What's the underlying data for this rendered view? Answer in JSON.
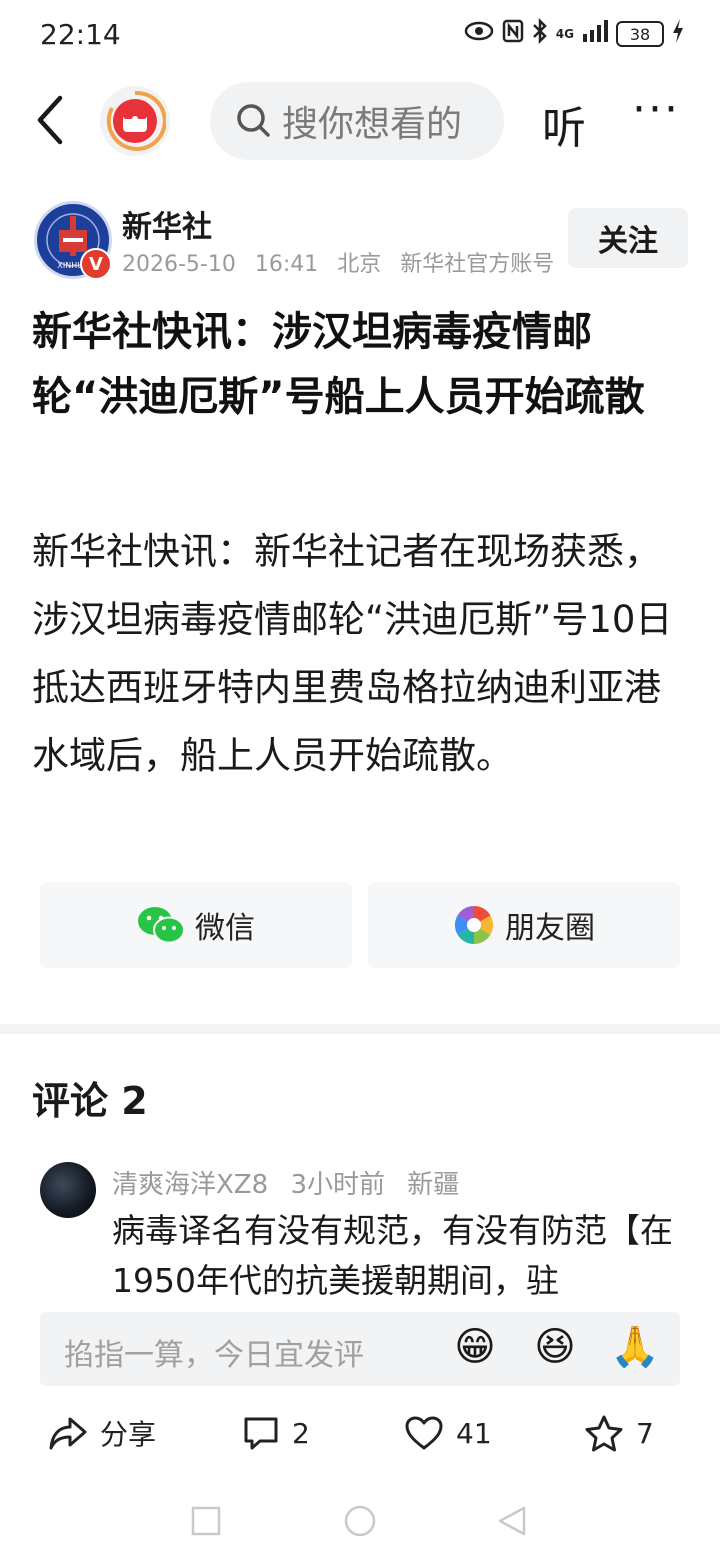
{
  "status_bar": {
    "time": "22:14",
    "network": "4G",
    "battery": "38"
  },
  "nav": {
    "search_placeholder": "搜你想看的",
    "listen_label": "听",
    "more_label": "···"
  },
  "author": {
    "name": "新华社",
    "date": "2026-5-10",
    "time": "16:41",
    "location": "北京",
    "account_type": "新华社官方账号",
    "verified_badge": "V",
    "follow_label": "关注"
  },
  "article": {
    "title": "新华社快讯：涉汉坦病毒疫情邮轮“洪迪厄斯”号船上人员开始疏散",
    "body": "新华社快讯：新华社记者在现场获悉，涉汉坦病毒疫情邮轮“洪迪厄斯”号10日抵达西班牙特内里费岛格拉纳迪利亚港水域后，船上人员开始疏散。"
  },
  "share": {
    "wechat_label": "微信",
    "moments_label": "朋友圈"
  },
  "comments": {
    "title": "评论 2",
    "items": [
      {
        "user": "清爽海洋XZ8",
        "time": "3小时前",
        "location": "新疆",
        "text": "病毒译名有没有规范，有没有防范【在1950年代的抗美援朝期间，驻"
      }
    ]
  },
  "input": {
    "placeholder": "掐指一算，今日宜发评",
    "emojis": [
      "😁",
      "😆",
      "🙏"
    ]
  },
  "actions": {
    "share_label": "分享",
    "comment_count": "2",
    "like_count": "41",
    "favorite_count": "7"
  },
  "colors": {
    "accent_red": "#e23b2e",
    "wechat_green": "#28c445",
    "muted_gray": "#9a9a9a",
    "bg_light": "#f1f2f4"
  }
}
